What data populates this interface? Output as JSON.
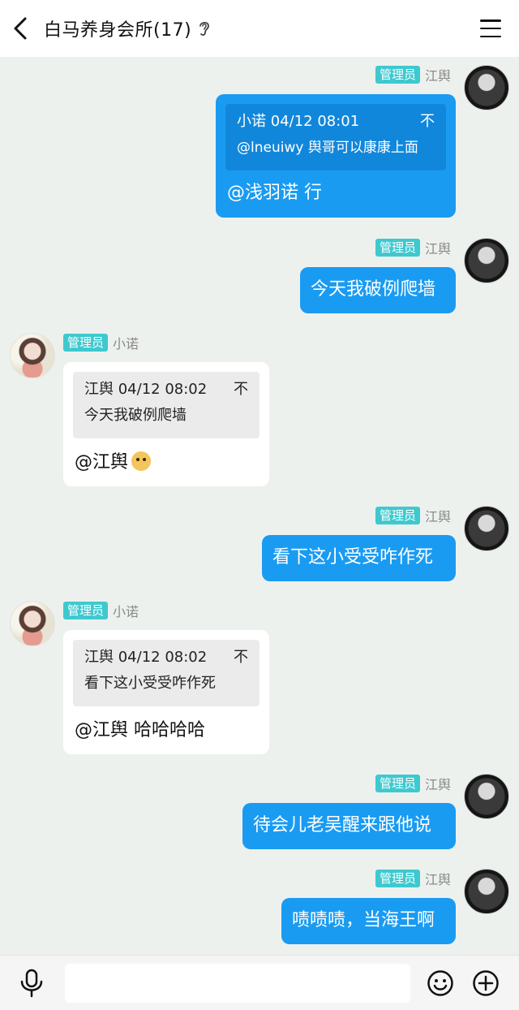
{
  "header": {
    "title": "白马养身会所(17)",
    "back_icon": "back-arrow-icon",
    "ear_icon": "ear-icon",
    "menu_icon": "menu-icon"
  },
  "messages": [
    {
      "side": "right",
      "badge": "管理员",
      "sender": "江舆",
      "quote_head": "小诺 04/12 08:01",
      "quote_body": "@lneuiwy 舆哥可以康康上面",
      "text": "@浅羽诺 行"
    },
    {
      "side": "right",
      "badge": "管理员",
      "sender": "江舆",
      "text": "今天我破例爬墙"
    },
    {
      "side": "left",
      "badge": "管理员",
      "sender": "小诺",
      "quote_head": "江舆 04/12 08:02",
      "quote_body": "今天我破例爬墙",
      "text": "@江舆"
    },
    {
      "side": "right",
      "badge": "管理员",
      "sender": "江舆",
      "text": "看下这小受受咋作死"
    },
    {
      "side": "left",
      "badge": "管理员",
      "sender": "小诺",
      "quote_head": "江舆 04/12 08:02",
      "quote_body": "看下这小受受咋作死",
      "text": "@江舆 哈哈哈哈"
    },
    {
      "side": "right",
      "badge": "管理员",
      "sender": "江舆",
      "text": "待会儿老吴醒来跟他说"
    },
    {
      "side": "right",
      "badge": "管理员",
      "sender": "江舆",
      "text": "啧啧啧，当海王啊"
    }
  ],
  "quote_pin": "不",
  "bottom": {
    "input_placeholder": "",
    "mic_icon": "microphone-icon",
    "emoji_icon": "emoji-icon",
    "plus_icon": "plus-icon"
  },
  "colors": {
    "accent_blue": "#1a9bf2",
    "badge_teal": "#3ec9cf",
    "background": "#edf1ee"
  }
}
